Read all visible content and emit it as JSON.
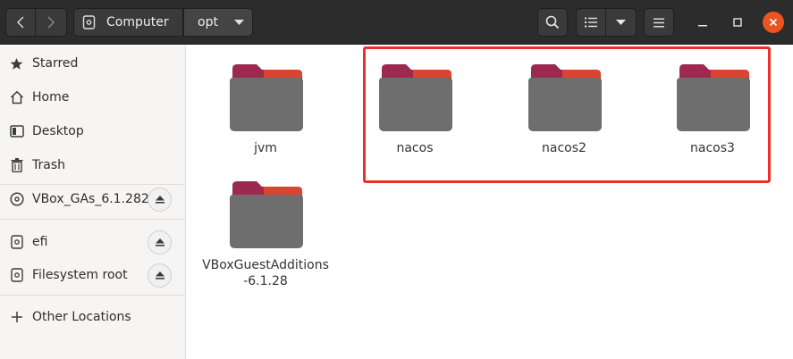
{
  "header": {
    "path_root_label": "Computer",
    "path_current_label": "opt",
    "back_icon": "chevron-left-icon",
    "forward_icon": "chevron-right-icon",
    "search_icon": "search-icon",
    "view_icon": "list-view-icon",
    "menu_icon": "hamburger-menu-icon"
  },
  "sidebar": {
    "items": [
      {
        "label": "Starred",
        "icon": "star-icon"
      },
      {
        "label": "Home",
        "icon": "home-icon"
      },
      {
        "label": "Desktop",
        "icon": "desktop-icon"
      },
      {
        "label": "Trash",
        "icon": "trash-icon"
      },
      {
        "label": "VBox_GAs_6.1.282",
        "icon": "optical-disc-icon",
        "ejectable": true
      },
      {
        "label": "efi",
        "icon": "drive-icon",
        "ejectable": true
      },
      {
        "label": "Filesystem root",
        "icon": "drive-icon",
        "ejectable": true
      },
      {
        "label": "Other Locations",
        "icon": "plus-icon"
      }
    ]
  },
  "files": [
    {
      "name": "jvm"
    },
    {
      "name": "nacos"
    },
    {
      "name": "nacos2"
    },
    {
      "name": "nacos3"
    },
    {
      "name": "VBoxGuestAdditions-6.1.28"
    }
  ],
  "colors": {
    "headerbar": "#2c2c2c",
    "accent": "#e95420",
    "folder_body": "#6e6e6e",
    "folder_tab": "#9c2a4f",
    "highlight": "#e8302e"
  }
}
